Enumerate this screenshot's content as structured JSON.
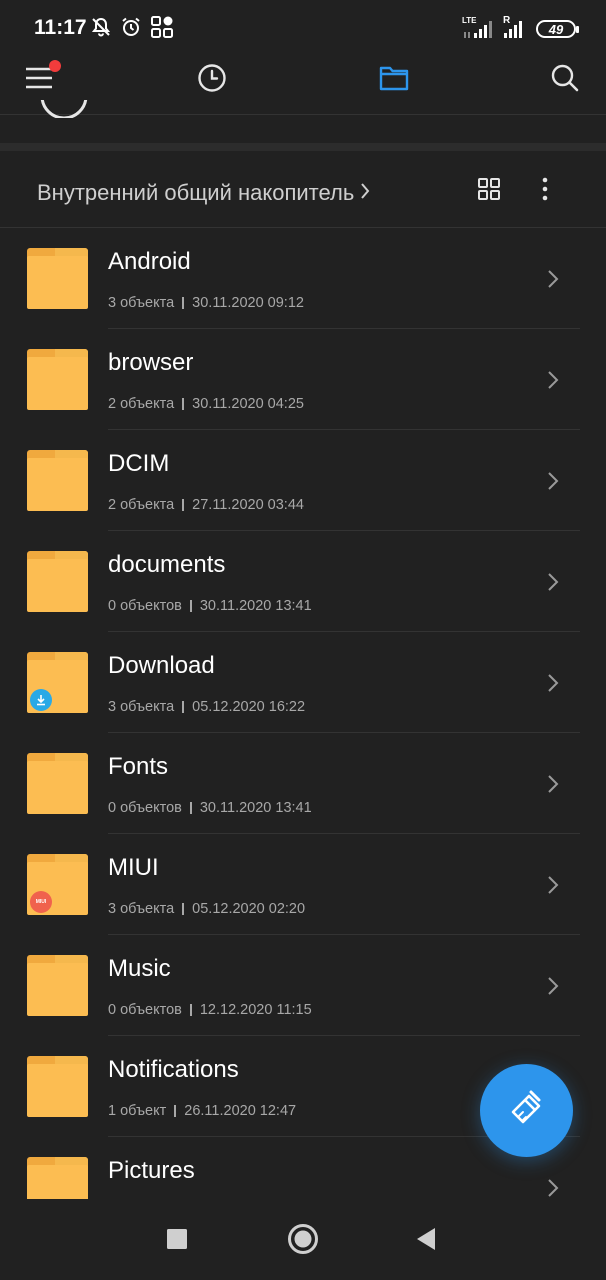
{
  "status_bar": {
    "time": "11:17",
    "network_label": "LTE",
    "roaming_label": "R",
    "battery": "49"
  },
  "toolbar": {
    "menu_icon": "hamburger-menu-icon",
    "recent_icon": "clock-icon",
    "files_icon": "folder-icon",
    "search_icon": "search-icon",
    "accent_color": "#2d95ec",
    "badge_color": "#f23c3c"
  },
  "path_bar": {
    "location": "Внутренний общий накопитель"
  },
  "folder_color": "#fcbd52",
  "files": [
    {
      "name": "Android",
      "count": "3 объекта",
      "date": "30.11.2020 09:12"
    },
    {
      "name": "browser",
      "count": "2 объекта",
      "date": "30.11.2020 04:25"
    },
    {
      "name": "DCIM",
      "count": "2 объекта",
      "date": "27.11.2020 03:44"
    },
    {
      "name": "documents",
      "count": "0 объектов",
      "date": "30.11.2020 13:41"
    },
    {
      "name": "Download",
      "count": "3 объекта",
      "date": "05.12.2020 16:22",
      "badge": "download-icon"
    },
    {
      "name": "Fonts",
      "count": "0 объектов",
      "date": "30.11.2020 13:41"
    },
    {
      "name": "MIUI",
      "count": "3 объекта",
      "date": "05.12.2020 02:20",
      "badge_text": "MIUI"
    },
    {
      "name": "Music",
      "count": "0 объектов",
      "date": "12.12.2020 11:15"
    },
    {
      "name": "Notifications",
      "count": "1 объект",
      "date": "26.11.2020 12:47"
    },
    {
      "name": "Pictures",
      "count": "",
      "date": ""
    }
  ],
  "fab": {
    "icon": "broom-clean-icon"
  },
  "nav_bar": {
    "recents_icon": "square-icon",
    "home_icon": "circle-icon",
    "back_icon": "triangle-back-icon"
  }
}
